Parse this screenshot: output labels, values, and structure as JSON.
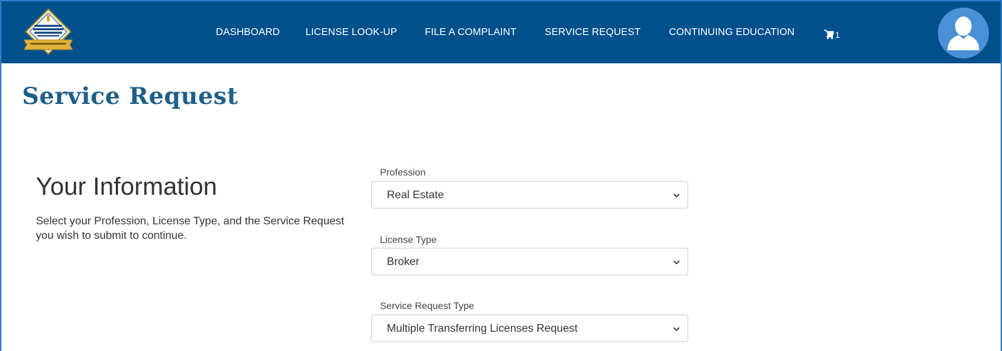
{
  "brand": {
    "logo_icon": "division-professional-regulation-seal-icon",
    "color_navbar": "#00508c",
    "color_title": "#1e5f8a",
    "color_avatar": "#4a90d4"
  },
  "nav": {
    "items": [
      {
        "label": "DASHBOARD"
      },
      {
        "label": "LICENSE LOOK-UP"
      },
      {
        "label": "FILE A COMPLAINT"
      },
      {
        "label": "SERVICE REQUEST"
      },
      {
        "label": "CONTINUING EDUCATION"
      }
    ],
    "cart_icon": "cart-icon",
    "cart_count": "1",
    "avatar_icon": "user-avatar-icon"
  },
  "page": {
    "title": "Service Request"
  },
  "info": {
    "heading": "Your Information",
    "description": "Select your Profession, License Type, and the Service Request you wish to submit to continue."
  },
  "form": {
    "profession": {
      "label": "Profession",
      "value": "Real Estate"
    },
    "license_type": {
      "label": "License Type",
      "value": "Broker"
    },
    "service_request_type": {
      "label": "Service Request Type",
      "value": "Multiple Transferring Licenses Request"
    }
  }
}
